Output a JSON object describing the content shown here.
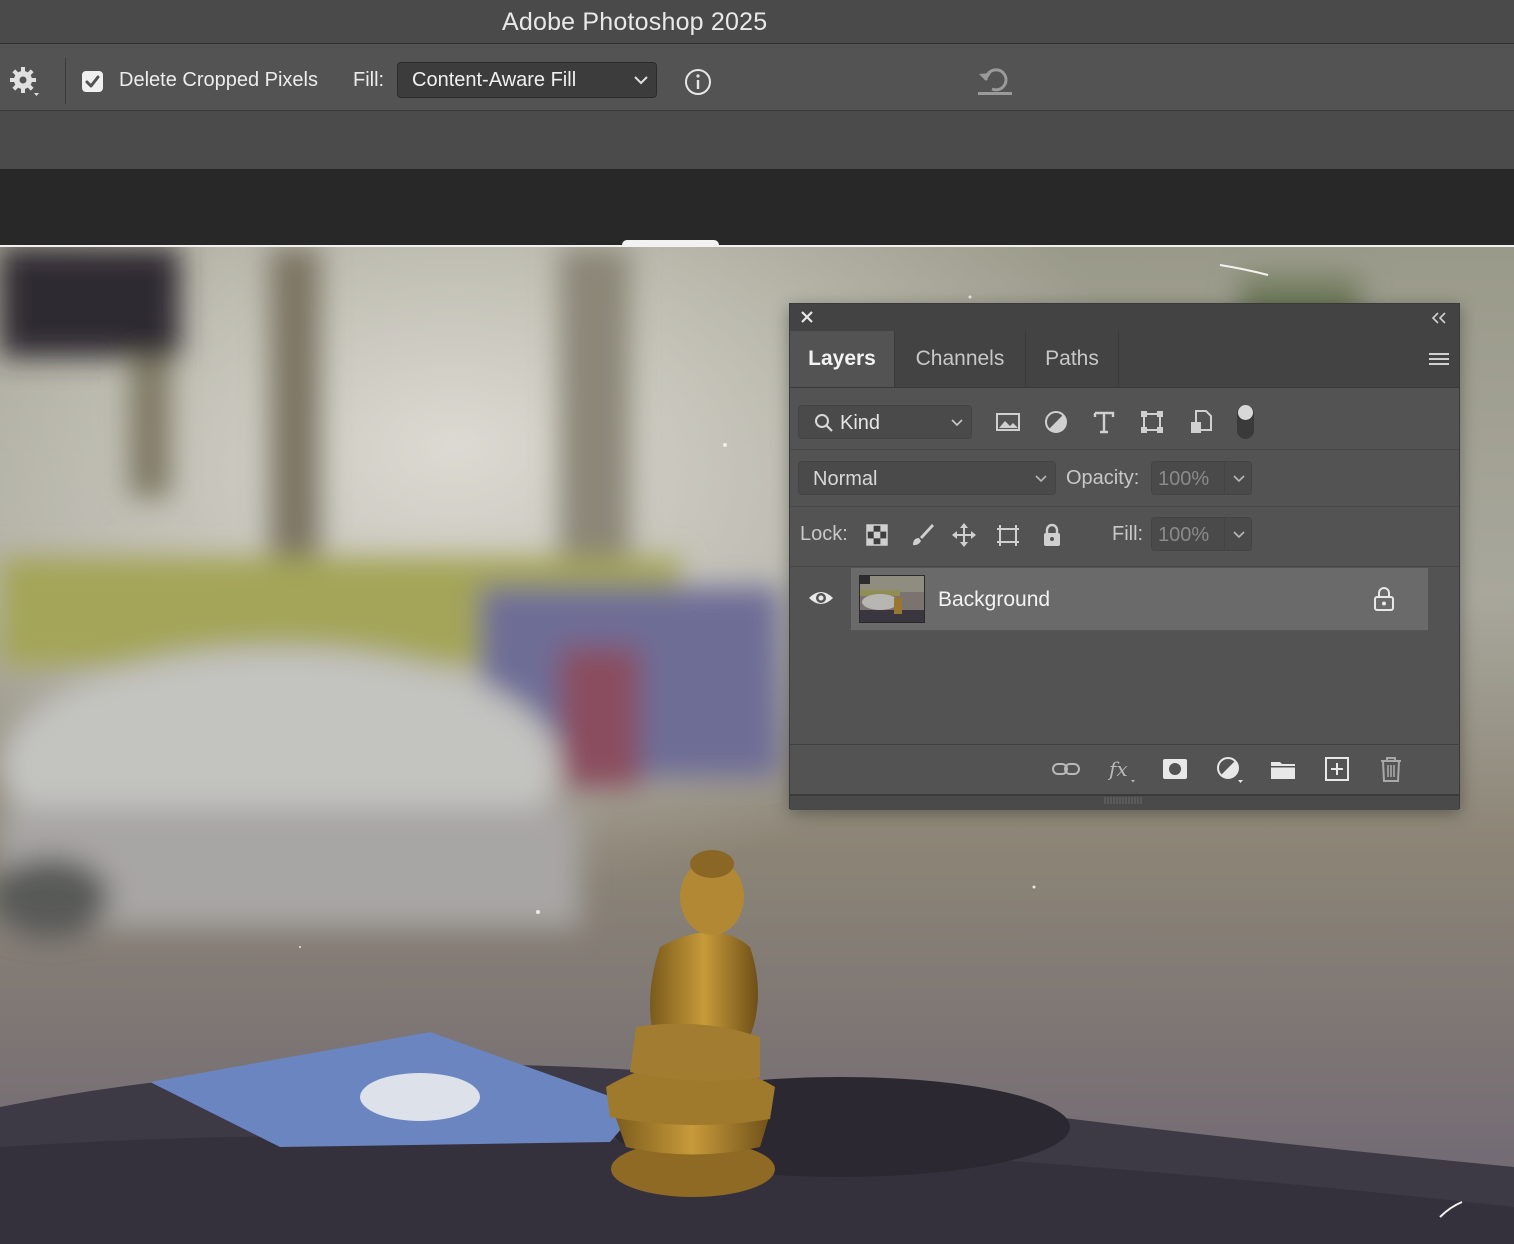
{
  "app": {
    "title": "Adobe Photoshop 2025"
  },
  "options_bar": {
    "settings_icon": "gear-icon",
    "delete_cropped_pixels": {
      "label": "Delete Cropped Pixels",
      "checked": true
    },
    "fill": {
      "label": "Fill:",
      "value": "Content-Aware Fill"
    },
    "info_icon": "info-icon",
    "reset_icon": "reset-icon"
  },
  "layers_panel": {
    "tabs": [
      {
        "label": "Layers",
        "active": true
      },
      {
        "label": "Channels",
        "active": false
      },
      {
        "label": "Paths",
        "active": false
      }
    ],
    "filter": {
      "placeholder": "Kind",
      "icons": [
        "image-filter-icon",
        "adjustment-filter-icon",
        "type-filter-icon",
        "shape-filter-icon",
        "smart-object-filter-icon"
      ]
    },
    "blend_mode": "Normal",
    "opacity": {
      "label": "Opacity:",
      "value": "100%"
    },
    "lock": {
      "label": "Lock:",
      "icons": [
        "lock-transparent-icon",
        "lock-paint-icon",
        "lock-position-icon",
        "lock-artboard-icon",
        "lock-all-icon"
      ]
    },
    "fill": {
      "label": "Fill:",
      "value": "100%"
    },
    "layers": [
      {
        "name": "Background",
        "visible": true,
        "locked": true
      }
    ],
    "footer_icons": [
      "link-icon",
      "fx-icon",
      "mask-icon",
      "adjustment-icon",
      "folder-icon",
      "new-layer-icon",
      "trash-icon"
    ]
  },
  "colors": {
    "ui_dark": "#282828",
    "panel": "#535353",
    "selected_layer": "#6a6a6a"
  }
}
